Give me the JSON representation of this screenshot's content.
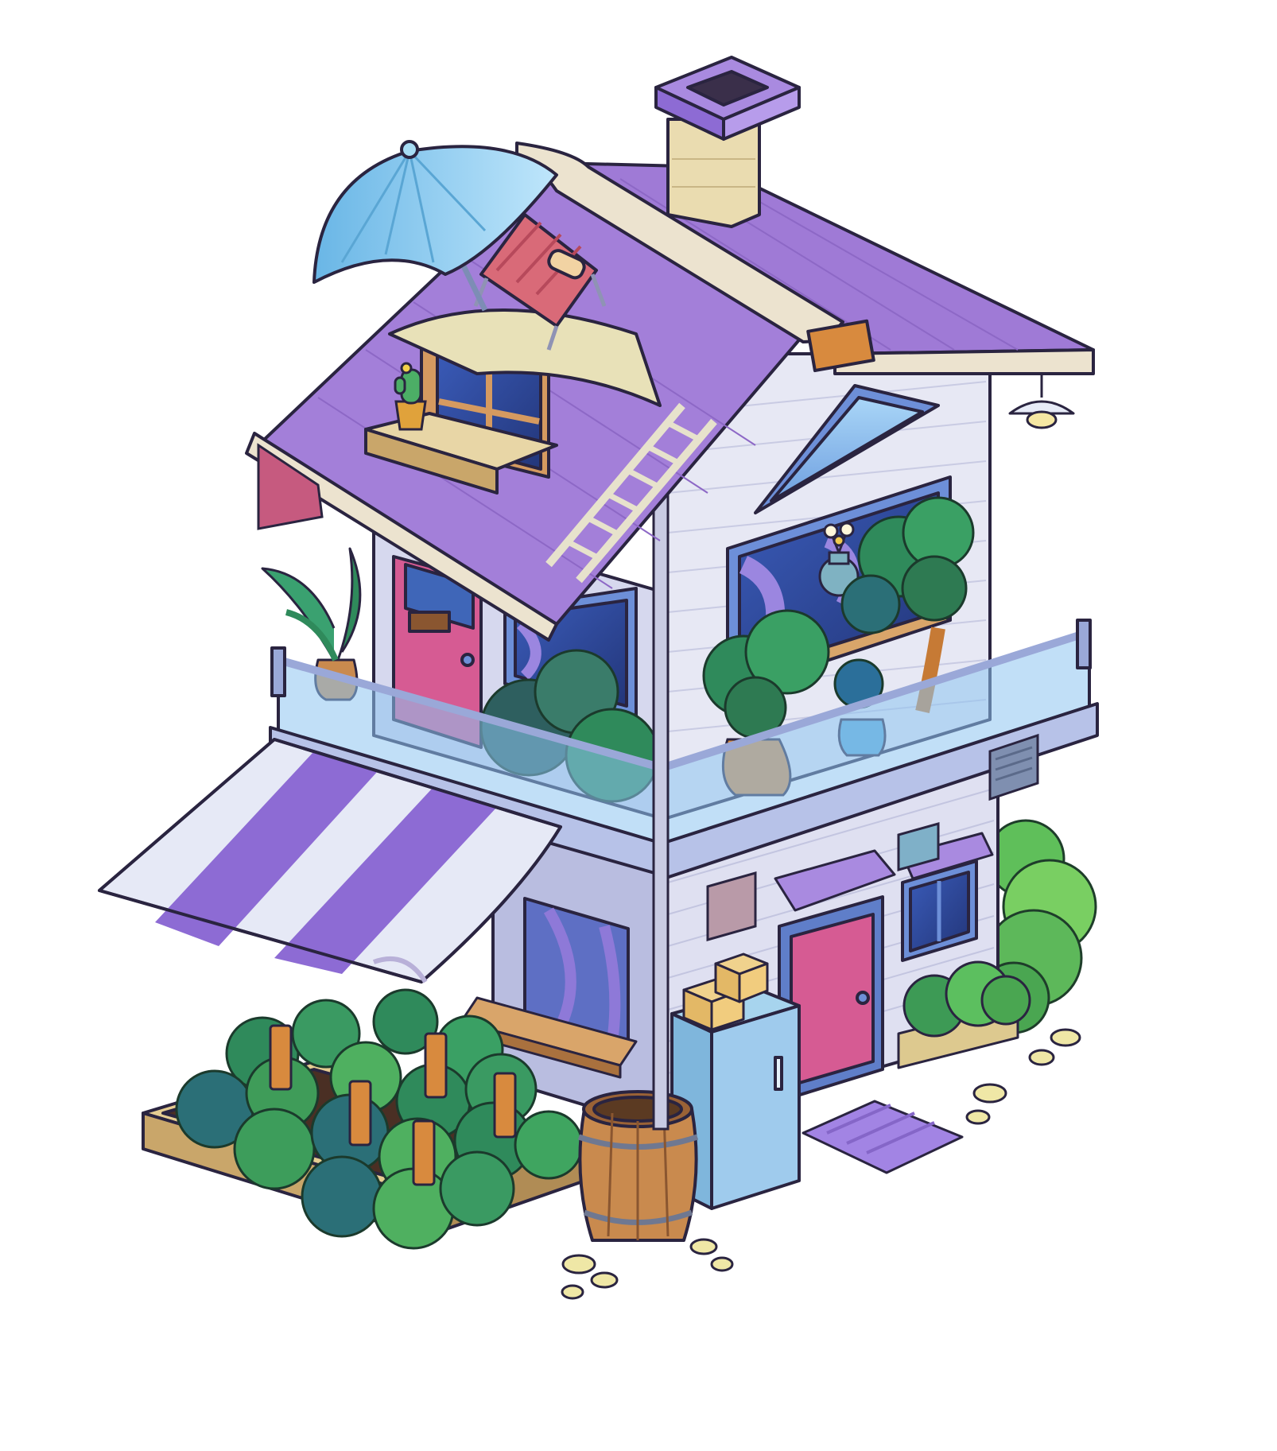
{
  "scene": {
    "subject": "isometric-house",
    "style": "cartoon isometric game asset",
    "background": "#ffffff"
  },
  "palette": {
    "outline": "#2a2440",
    "roof_purple": "#9f7ad6",
    "roof_purple_dark": "#7e57c2",
    "roof_trim": "#ece3cf",
    "wall_light": "#e7e8f4",
    "wall_shade": "#c9cbe3",
    "blue_trim": "#6d8fd8",
    "glass": "#8ec5f0",
    "door_pink": "#d65b93",
    "bush_green": "#2f9a63",
    "bush_light": "#6fd38f",
    "bush_dark": "#1f6d52",
    "wood": "#c98a4e",
    "wood_dark": "#8a5630",
    "soil": "#4b3126",
    "awning_stripe": "#8d6bd4",
    "umbrella_blue": "#8fd0f0",
    "lawn_chair_red": "#d96a78",
    "doormat_purple": "#a284e4",
    "stone": "#efe7a6"
  },
  "objects": [
    {
      "id": "chimney",
      "icon": "chimney-icon"
    },
    {
      "id": "roof",
      "icon": "roof-icon"
    },
    {
      "id": "umbrella",
      "icon": "umbrella-icon"
    },
    {
      "id": "lawn-chair",
      "icon": "lawn-chair-icon"
    },
    {
      "id": "dormer-window",
      "icon": "window-icon"
    },
    {
      "id": "cactus",
      "icon": "cactus-icon"
    },
    {
      "id": "ladder",
      "icon": "ladder-icon"
    },
    {
      "id": "hanging-lamp",
      "icon": "lamp-icon"
    },
    {
      "id": "balcony",
      "icon": "balcony-icon"
    },
    {
      "id": "potted-plant",
      "icon": "plant-icon"
    },
    {
      "id": "bonsai-trees",
      "icon": "tree-icon"
    },
    {
      "id": "flower-vase",
      "icon": "flower-icon"
    },
    {
      "id": "striped-awning",
      "icon": "awning-icon"
    },
    {
      "id": "garden-bed",
      "icon": "garden-icon"
    },
    {
      "id": "barrel",
      "icon": "barrel-icon"
    },
    {
      "id": "utility-cabinet",
      "icon": "cabinet-icon"
    },
    {
      "id": "boxes",
      "icon": "box-icon"
    },
    {
      "id": "front-door",
      "icon": "door-icon"
    },
    {
      "id": "doormat",
      "icon": "mat-icon"
    },
    {
      "id": "side-hedge",
      "icon": "bush-icon"
    },
    {
      "id": "stepping-stones",
      "icon": "stone-icon"
    }
  ]
}
